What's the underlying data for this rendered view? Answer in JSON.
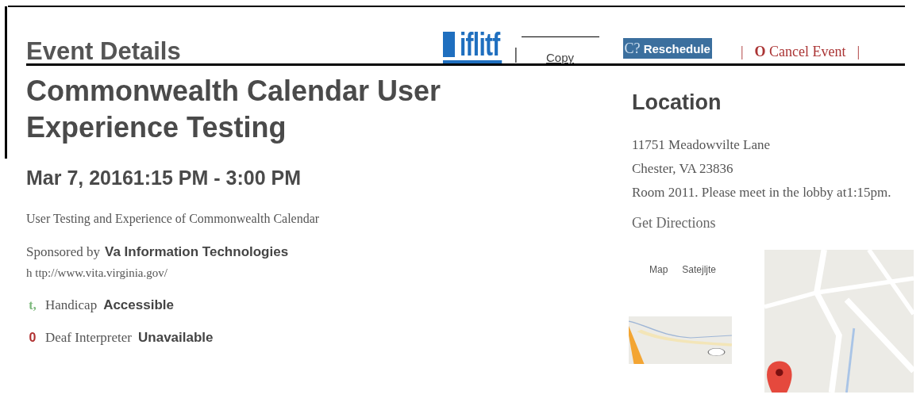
{
  "header": {
    "title": "Event Details",
    "logo": "iflitf",
    "separator": "|",
    "actions": [
      {
        "kind": "link",
        "label": "Copy"
      },
      {
        "kind": "primary",
        "icon": "C?",
        "label": "Reschedule"
      },
      {
        "kind": "danger",
        "icon": "O",
        "label": "Cancel Event",
        "left": "|",
        "right": "|"
      }
    ]
  },
  "event": {
    "title": "Commonwealth Calendar User Experience Testing",
    "when": "Mar 7, 20161:15 PM - 3:00 PM",
    "description": "User Testing and Experience of Commonwealth Calendar",
    "sponsor_label": "Sponsored by",
    "sponsor": "Va Information Technologies",
    "url": "h ttp://www.vita.virginia.gov/",
    "features": [
      {
        "icon": "t,",
        "label": "Handicap",
        "status": "Accessible",
        "available": true
      },
      {
        "icon": "0",
        "label": "Deaf Interpreter",
        "status": "Unavailable",
        "available": false
      }
    ]
  },
  "location": {
    "heading": "Location",
    "lines": [
      "11751 Meadowvilte Lane",
      "Chester, VA 23836",
      "Room 2011. Please meet in the  lobby at1:15pm."
    ],
    "directions": "Get Directions",
    "map_tabs": [
      {
        "label": "Map"
      },
      {
        "label": "Satejljte"
      }
    ]
  }
}
